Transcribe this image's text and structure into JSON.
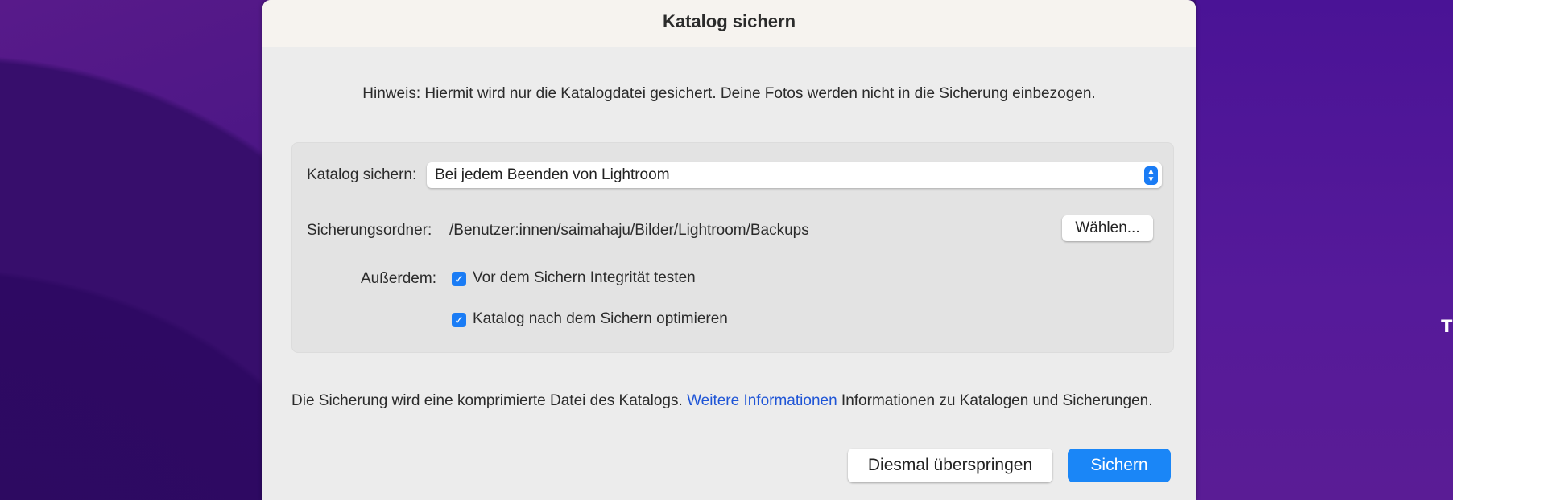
{
  "dialog": {
    "title": "Katalog sichern",
    "hint": "Hinweis: Hiermit wird nur die Katalogdatei gesichert. Deine Fotos werden nicht in die Sicherung einbezogen.",
    "backup_label": "Katalog sichern:",
    "backup_value": "Bei jedem Beenden von Lightroom",
    "folder_label": "Sicherungsordner:",
    "folder_path": "/Benutzer:innen/saimahaju/Bilder/Lightroom/Backups",
    "choose_button": "Wählen...",
    "also_label": "Außerdem:",
    "options": [
      {
        "label": "Vor dem Sichern Integrität testen",
        "checked": true
      },
      {
        "label": "Katalog nach dem Sichern optimieren",
        "checked": true
      }
    ],
    "footer_text": "Die Sicherung wird eine komprimierte Datei des Katalogs.",
    "footer_link": "Weitere Informationen",
    "footer_after": "Informationen zu Katalogen und Sicherungen.",
    "skip_button": "Diesmal überspringen",
    "save_button": "Sichern"
  },
  "desktop": {
    "edge_text": "T"
  },
  "colors": {
    "accent": "#1a86f7",
    "link": "#1f55d6",
    "desktop": "#4a1685"
  }
}
